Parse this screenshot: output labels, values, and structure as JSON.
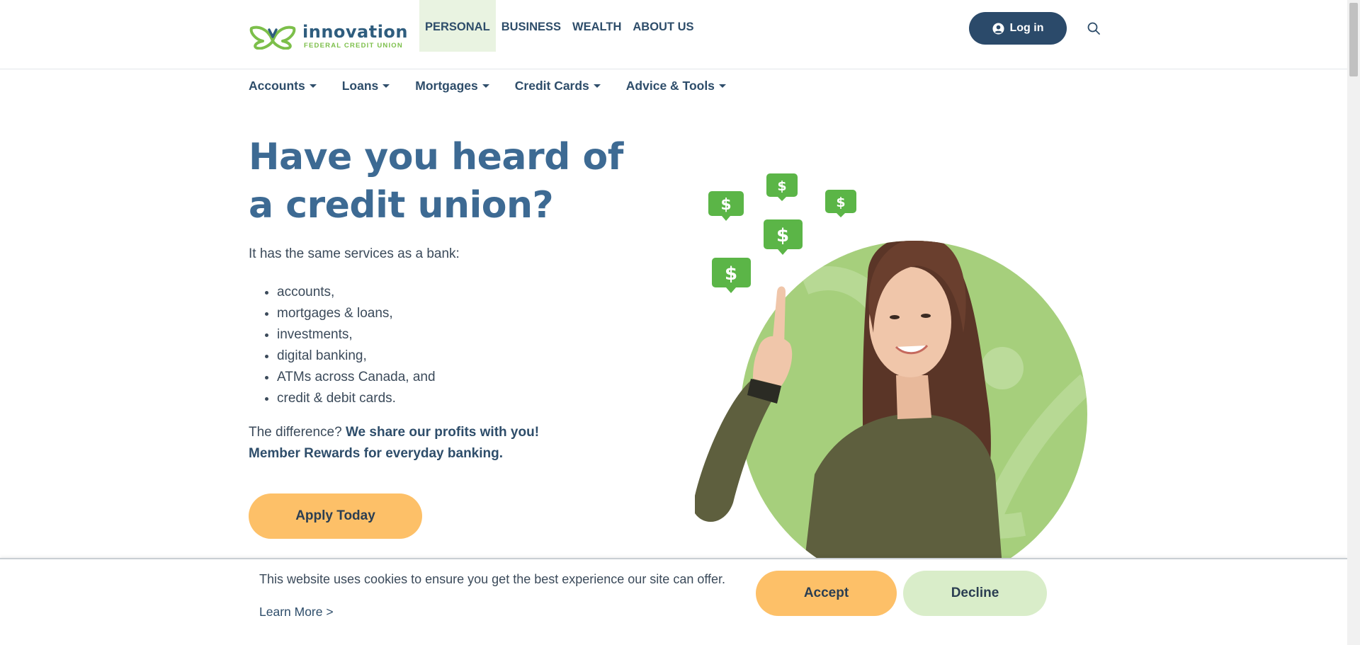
{
  "header": {
    "logo_name": "innovation",
    "logo_sub": "FEDERAL CREDIT UNION",
    "nav": [
      {
        "label": "PERSONAL",
        "active": true
      },
      {
        "label": "BUSINESS",
        "active": false
      },
      {
        "label": "WEALTH",
        "active": false
      },
      {
        "label": "ABOUT US",
        "active": false
      }
    ],
    "login_label": "Log in",
    "search_icon": "search-icon"
  },
  "subnav": {
    "items": [
      "Accounts",
      "Loans",
      "Mortgages",
      "Credit Cards",
      "Advice & Tools"
    ]
  },
  "hero": {
    "title": "Have you heard of a credit union?",
    "intro": "It has the same services as a bank:",
    "features": [
      "accounts,",
      "mortgages & loans,",
      "investments,",
      "digital banking,",
      "ATMs across Canada, and",
      "credit & debit cards."
    ],
    "diff_prefix": "The difference? ",
    "diff_bold_1": "We share our profits with you!",
    "diff_bold_2": "Member Rewards for everyday banking.",
    "apply_label": "Apply Today",
    "dollar_symbol": "$"
  },
  "cookie": {
    "text": "This website uses cookies to ensure you get the best experience our site can offer.",
    "learn_more": "Learn More >",
    "accept_label": "Accept",
    "decline_label": "Decline"
  },
  "colors": {
    "brand_blue": "#2b4a6a",
    "heading_blue": "#3d6a93",
    "brand_green": "#7cbf4a",
    "accent_orange": "#fdc068",
    "light_green": "#d9edc9"
  }
}
